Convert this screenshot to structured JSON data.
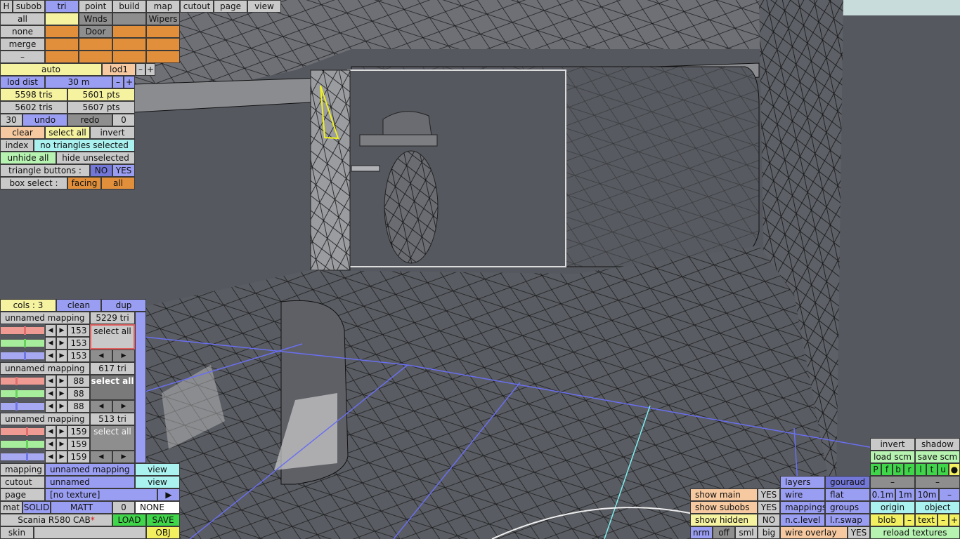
{
  "colors": {
    "bg": "#55585f",
    "blue_btn": "#9a9ef2",
    "yellow_btn": "#f5f2a0",
    "orange_btn": "#e18f3b",
    "wire_blue": "#6a6ff0",
    "wire_cyan": "#7ef0f0",
    "select_tri": "#f0f020"
  },
  "menu": {
    "h": "H",
    "subob": "subob",
    "tri": "tri",
    "point": "point",
    "build": "build",
    "map": "map",
    "cutout": "cutout",
    "page": "page",
    "view": "view"
  },
  "subobjects": {
    "all": "all",
    "none": "none",
    "merge": "merge",
    "dash": "–",
    "wnds": "Wnds",
    "wipers": "Wipers",
    "door": "Door"
  },
  "lod": {
    "auto": "auto",
    "lod1": "lod1",
    "minus": "–",
    "plus": "+",
    "dist_label": "lod dist",
    "dist_value": "30 m"
  },
  "stats": {
    "tris1": "5598 tris",
    "pts1": "5601 pts",
    "tris2": "5602 tris",
    "pts2": "5607 pts"
  },
  "undo": {
    "count": "30",
    "undo": "undo",
    "redo": "redo",
    "zero": "0"
  },
  "selection": {
    "clear": "clear",
    "select_all": "select all",
    "invert": "invert",
    "index": "index",
    "status": "no triangles selected",
    "unhide_all": "unhide all",
    "hide_unselected": "hide unselected",
    "tri_buttons_label": "triangle buttons :",
    "no": "NO",
    "yes": "YES",
    "box_select_label": "box select :",
    "facing": "facing",
    "all": "all"
  },
  "mappings": {
    "cols": "cols : 3",
    "clean": "clean",
    "dup": "dup",
    "items": [
      {
        "name": "unnamed mapping",
        "tris": "5229 tri",
        "vals": [
          "153",
          "153",
          "153"
        ],
        "select": "select all",
        "levels": [
          0.55,
          0.55,
          0.55
        ]
      },
      {
        "name": "unnamed mapping",
        "tris": "617 tri",
        "vals": [
          "88",
          "88",
          "88"
        ],
        "select": "select all",
        "levels": [
          0.35,
          0.35,
          0.35
        ]
      },
      {
        "name": "unnamed mapping",
        "tris": "513 tri",
        "vals": [
          "159",
          "159",
          "159"
        ],
        "select": "select all",
        "levels": [
          0.6,
          0.6,
          0.6
        ]
      }
    ]
  },
  "bottom_left": {
    "mapping_label": "mapping",
    "mapping_value": "unnamed mapping",
    "view": "view",
    "cutout_label": "cutout",
    "cutout_value": "unnamed",
    "page_label": "page",
    "page_value": "[no texture]",
    "page_arrow": "▶",
    "mat": "mat",
    "solid": "SOLID",
    "matt": "MATT",
    "mat_num": "0",
    "none": "NONE",
    "file": "Scania R580 CAB",
    "modified": "*",
    "load": "LOAD",
    "save": "SAVE",
    "skin": "skin",
    "obj": "OBJ"
  },
  "bottom_right": {
    "invert": "invert",
    "shadow": "shadow",
    "load_scm": "load scm",
    "save_scm": "save scm",
    "flags": [
      "P",
      "f",
      "b",
      "r",
      "l",
      "t",
      "u",
      "●"
    ],
    "dash": "–",
    "show_main": "show main",
    "show_main_v": "YES",
    "show_subobs": "show subobs",
    "show_subobs_v": "YES",
    "show_hidden": "show hidden",
    "show_hidden_v": "NO",
    "nrm": "nrm",
    "off": "off",
    "sml": "sml",
    "big": "big",
    "layers": "layers",
    "gouraud": "gouraud",
    "wire": "wire",
    "flat": "flat",
    "mappings": "mappings",
    "groups": "groups",
    "nc_level": "n.c.level",
    "lr_swap": "l.r.swap",
    "wire_overlay": "wire overlay",
    "wire_overlay_v": "YES",
    "d01": "0.1m",
    "d1": "1m",
    "d10": "10m",
    "origin": "origin",
    "object": "object",
    "blob": "blob",
    "text": "text",
    "minus": "–",
    "plus": "+",
    "reload": "reload textures"
  }
}
